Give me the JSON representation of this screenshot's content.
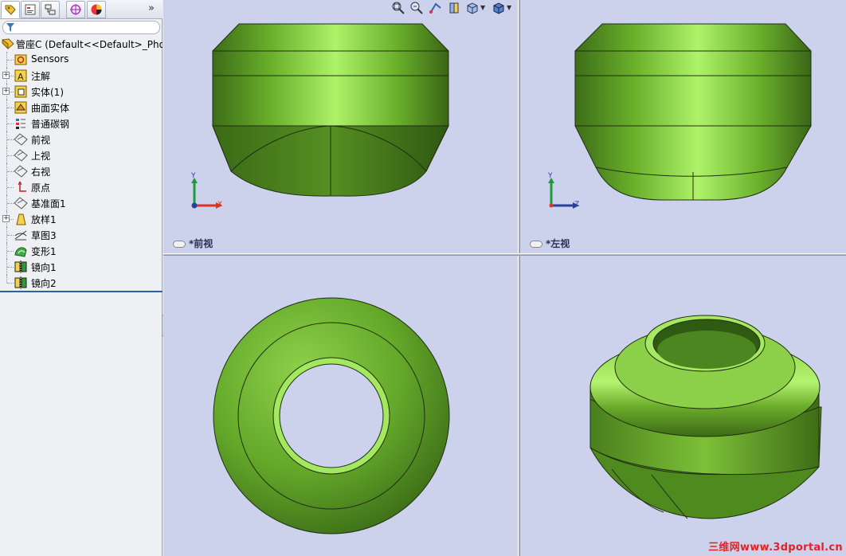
{
  "feature_tree": {
    "root_label": "管座C  (Default<<Default>_Phot",
    "items": [
      {
        "label": "Sensors",
        "icon": "sensors-icon",
        "expandable": false
      },
      {
        "label": "注解",
        "icon": "annotations-icon",
        "expandable": true
      },
      {
        "label": "实体(1)",
        "icon": "solid-bodies-icon",
        "expandable": true
      },
      {
        "label": "曲面实体",
        "icon": "surface-bodies-icon",
        "expandable": false
      },
      {
        "label": "普通碳钢",
        "icon": "material-icon",
        "expandable": false
      },
      {
        "label": "前视",
        "icon": "plane-icon",
        "expandable": false
      },
      {
        "label": "上视",
        "icon": "plane-icon",
        "expandable": false
      },
      {
        "label": "右视",
        "icon": "plane-icon",
        "expandable": false
      },
      {
        "label": "原点",
        "icon": "origin-icon",
        "expandable": false
      },
      {
        "label": "基准面1",
        "icon": "plane-icon",
        "expandable": false
      },
      {
        "label": "放样1",
        "icon": "loft-icon",
        "expandable": true
      },
      {
        "label": "草图3",
        "icon": "sketch-icon",
        "expandable": false
      },
      {
        "label": "变形1",
        "icon": "deform-icon",
        "expandable": false
      },
      {
        "label": "镜向1",
        "icon": "mirror-icon",
        "expandable": false
      },
      {
        "label": "镜向2",
        "icon": "mirror-icon",
        "expandable": false
      }
    ]
  },
  "panel_tabs": [
    "featuremanager-tab-icon",
    "propertymanager-tab-icon",
    "configurationmanager-tab-icon",
    "dimxpert-tab-icon",
    "display-manager-tab-icon"
  ],
  "panel_more": "»",
  "viewports": {
    "front": {
      "label": "*前视",
      "axes": {
        "y": "Y",
        "x": "X"
      }
    },
    "left": {
      "label": "*左视",
      "axes": {
        "y": "Y",
        "x": "Z"
      }
    }
  },
  "watermark": "三维网www.3dportal.cn",
  "colors": {
    "viewport_bg": "#ccd2ec",
    "part_green": "#6aac2a",
    "part_light": "#a6e862",
    "part_dark": "#3f6e17"
  }
}
